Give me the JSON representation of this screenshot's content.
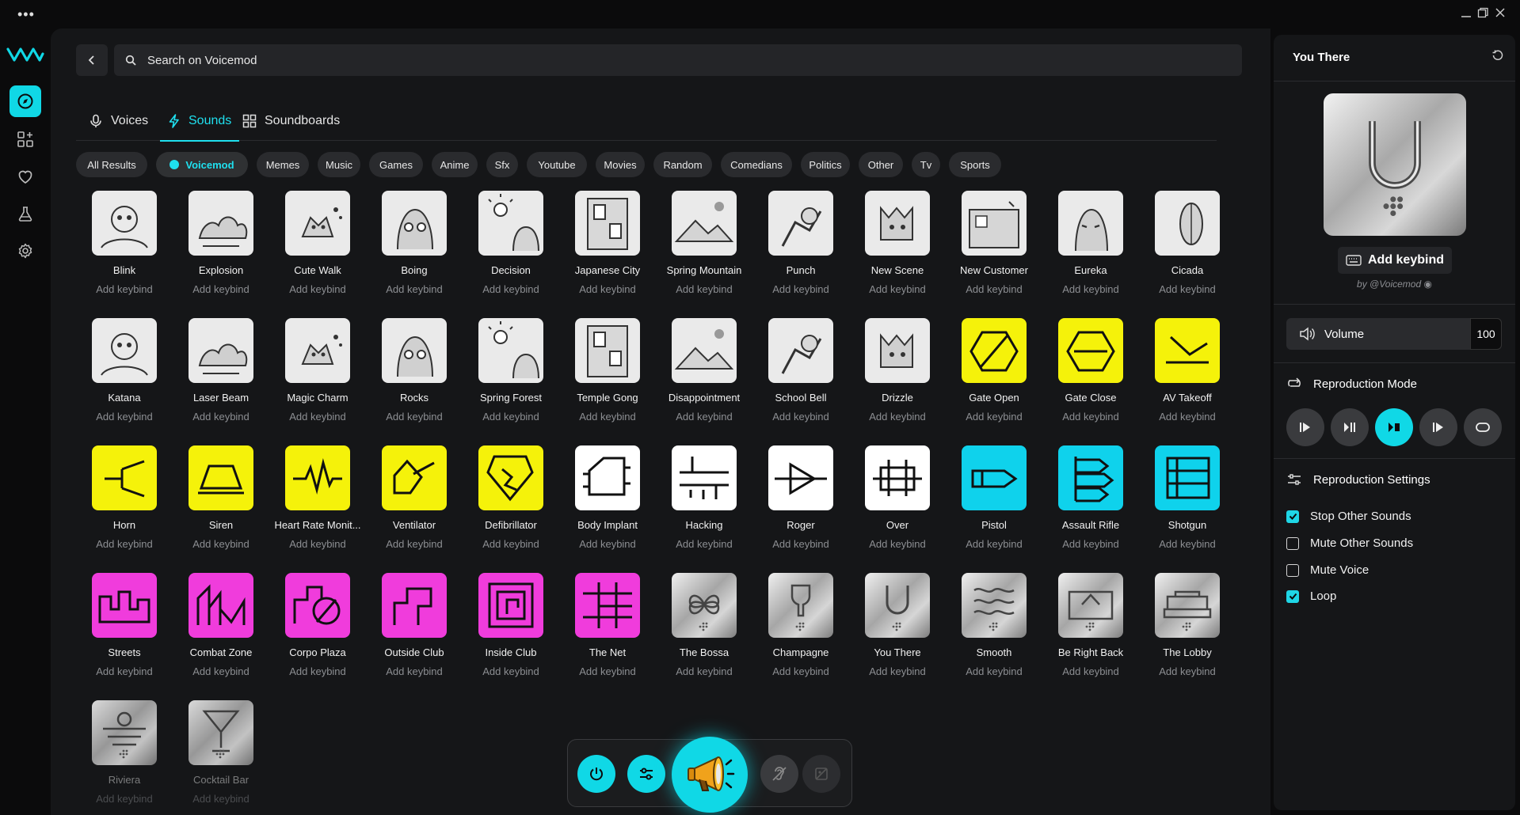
{
  "search": {
    "placeholder": "Search on Voicemod"
  },
  "tabs": [
    {
      "label": "Voices",
      "icon": "mic-icon"
    },
    {
      "label": "Sounds",
      "icon": "bolt-icon"
    },
    {
      "label": "Soundboards",
      "icon": "grid-icon"
    }
  ],
  "chips": [
    "All Results",
    "Voicemod",
    "Memes",
    "Music",
    "Games",
    "Anime",
    "Sfx",
    "Youtube",
    "Movies",
    "Random",
    "Comedians",
    "Politics",
    "Other",
    "Tv",
    "Sports"
  ],
  "keybind_label": "Add keybind",
  "sounds": [
    {
      "name": "Blink",
      "style": "sketch"
    },
    {
      "name": "Explosion",
      "style": "sketch"
    },
    {
      "name": "Cute Walk",
      "style": "sketch"
    },
    {
      "name": "Boing",
      "style": "sketch"
    },
    {
      "name": "Decision",
      "style": "sketch"
    },
    {
      "name": "Japanese City",
      "style": "sketch"
    },
    {
      "name": "Spring Mountain",
      "style": "sketch"
    },
    {
      "name": "Punch",
      "style": "sketch"
    },
    {
      "name": "New Scene",
      "style": "sketch"
    },
    {
      "name": "New Customer",
      "style": "sketch"
    },
    {
      "name": "Eureka",
      "style": "sketch"
    },
    {
      "name": "Cicada",
      "style": "sketch"
    },
    {
      "name": "Katana",
      "style": "sketch"
    },
    {
      "name": "Laser Beam",
      "style": "sketch"
    },
    {
      "name": "Magic Charm",
      "style": "sketch"
    },
    {
      "name": "Rocks",
      "style": "sketch"
    },
    {
      "name": "Spring Forest",
      "style": "sketch"
    },
    {
      "name": "Temple Gong",
      "style": "sketch"
    },
    {
      "name": "Disappointment",
      "style": "sketch"
    },
    {
      "name": "School Bell",
      "style": "sketch"
    },
    {
      "name": "Drizzle",
      "style": "sketch"
    },
    {
      "name": "Gate Open",
      "style": "yellow"
    },
    {
      "name": "Gate Close",
      "style": "yellow"
    },
    {
      "name": "AV Takeoff",
      "style": "yellow"
    },
    {
      "name": "Horn",
      "style": "yellow"
    },
    {
      "name": "Siren",
      "style": "yellow"
    },
    {
      "name": "Heart Rate Monit...",
      "style": "yellow"
    },
    {
      "name": "Ventilator",
      "style": "yellow"
    },
    {
      "name": "Defibrillator",
      "style": "yellow"
    },
    {
      "name": "Body Implant",
      "style": "white"
    },
    {
      "name": "Hacking",
      "style": "white"
    },
    {
      "name": "Roger",
      "style": "white"
    },
    {
      "name": "Over",
      "style": "white"
    },
    {
      "name": "Pistol",
      "style": "cyan"
    },
    {
      "name": "Assault Rifle",
      "style": "cyan"
    },
    {
      "name": "Shotgun",
      "style": "cyan"
    },
    {
      "name": "Streets",
      "style": "magenta"
    },
    {
      "name": "Combat Zone",
      "style": "magenta"
    },
    {
      "name": "Corpo Plaza",
      "style": "magenta"
    },
    {
      "name": "Outside Club",
      "style": "magenta"
    },
    {
      "name": "Inside Club",
      "style": "magenta"
    },
    {
      "name": "The Net",
      "style": "magenta"
    },
    {
      "name": "The Bossa",
      "style": "metal"
    },
    {
      "name": "Champagne",
      "style": "metal"
    },
    {
      "name": "You There",
      "style": "metal"
    },
    {
      "name": "Smooth",
      "style": "metal"
    },
    {
      "name": "Be Right Back",
      "style": "metal"
    },
    {
      "name": "The Lobby",
      "style": "metal"
    },
    {
      "name": "Riviera",
      "style": "metal"
    },
    {
      "name": "Cocktail Bar",
      "style": "metal"
    }
  ],
  "panel": {
    "title": "You There",
    "keybind_label": "Add keybind",
    "author": "by @Voicemod",
    "volume_label": "Volume",
    "volume_value": "100",
    "repro_mode_label": "Reproduction Mode",
    "repro_settings_label": "Reproduction Settings",
    "options": [
      {
        "label": "Stop Other Sounds",
        "checked": true
      },
      {
        "label": "Mute Other Sounds",
        "checked": false
      },
      {
        "label": "Mute Voice",
        "checked": false
      },
      {
        "label": "Loop",
        "checked": true
      }
    ]
  },
  "colors": {
    "accent": "#10d8e6",
    "yellow": "#f5f20a",
    "magenta": "#f03cdc",
    "cyan": "#0fd2ec"
  }
}
